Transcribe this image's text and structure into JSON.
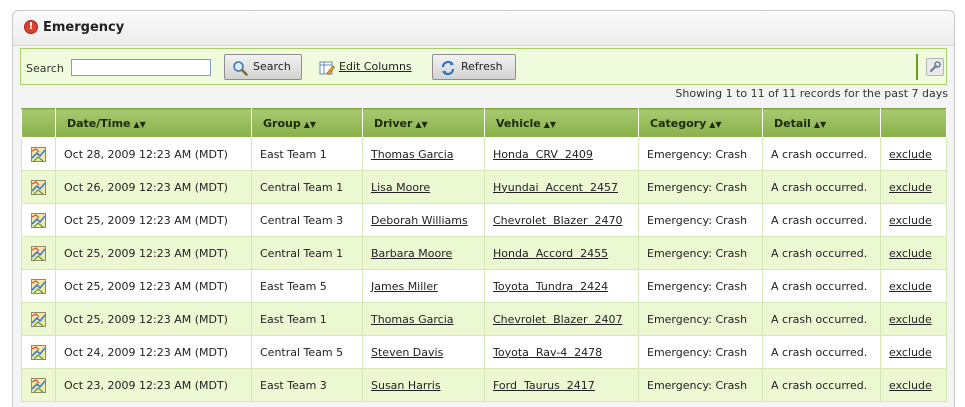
{
  "panel": {
    "title": "Emergency",
    "alert_glyph": "!"
  },
  "toolbar": {
    "search_label": "Search",
    "search_value": "",
    "search_button": "Search",
    "edit_columns": "Edit Columns",
    "refresh_button": "Refresh"
  },
  "records_info": "Showing 1 to 11 of 11 records for the past 7 days",
  "colors": {
    "header_green": "#98bd5b",
    "row_alt": "#ebf8d2",
    "alert_red": "#d9412f"
  },
  "columns": [
    "Date/Time",
    "Group",
    "Driver",
    "Vehicle",
    "Category",
    "Detail"
  ],
  "sort_glyph": "▲▼",
  "exclude_label": "exclude",
  "rows": [
    {
      "datetime": "Oct 28, 2009 12:23 AM (MDT)",
      "group": "East Team 1",
      "driver": "Thomas Garcia",
      "vehicle": "Honda  CRV  2409",
      "category": "Emergency: Crash",
      "detail": "A crash occurred."
    },
    {
      "datetime": "Oct 26, 2009 12:23 AM (MDT)",
      "group": "Central Team 1",
      "driver": "Lisa Moore",
      "vehicle": "Hyundai  Accent  2457",
      "category": "Emergency: Crash",
      "detail": "A crash occurred."
    },
    {
      "datetime": "Oct 25, 2009 12:23 AM (MDT)",
      "group": "Central Team 3",
      "driver": "Deborah Williams",
      "vehicle": "Chevrolet  Blazer  2470",
      "category": "Emergency: Crash",
      "detail": "A crash occurred."
    },
    {
      "datetime": "Oct 25, 2009 12:23 AM (MDT)",
      "group": "Central Team 1",
      "driver": "Barbara Moore",
      "vehicle": "Honda  Accord  2455",
      "category": "Emergency: Crash",
      "detail": "A crash occurred."
    },
    {
      "datetime": "Oct 25, 2009 12:23 AM (MDT)",
      "group": "East Team 5",
      "driver": "James Miller",
      "vehicle": "Toyota  Tundra  2424",
      "category": "Emergency: Crash",
      "detail": "A crash occurred."
    },
    {
      "datetime": "Oct 25, 2009 12:23 AM (MDT)",
      "group": "East Team 1",
      "driver": "Thomas Garcia",
      "vehicle": "Chevrolet  Blazer  2407",
      "category": "Emergency: Crash",
      "detail": "A crash occurred."
    },
    {
      "datetime": "Oct 24, 2009 12:23 AM (MDT)",
      "group": "Central Team 5",
      "driver": "Steven Davis",
      "vehicle": "Toyota  Rav-4  2478",
      "category": "Emergency: Crash",
      "detail": "A crash occurred."
    },
    {
      "datetime": "Oct 23, 2009 12:23 AM (MDT)",
      "group": "East Team 3",
      "driver": "Susan Harris",
      "vehicle": "Ford  Taurus  2417",
      "category": "Emergency: Crash",
      "detail": "A crash occurred."
    }
  ],
  "icons": {
    "alert": "alert-icon",
    "search": "magnifier-icon",
    "edit_columns": "edit-columns-icon",
    "refresh": "refresh-icon",
    "settings": "wrench-icon",
    "row_map": "map-icon"
  }
}
